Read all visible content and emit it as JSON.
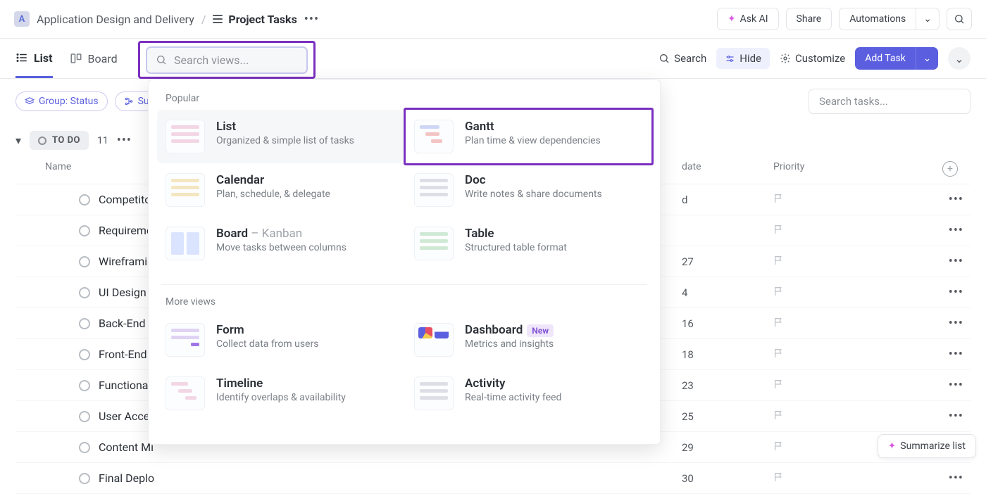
{
  "header": {
    "app_letter": "A",
    "breadcrumb_project": "Application Design and Delivery",
    "page_title": "Project Tasks",
    "ask_ai": "Ask AI",
    "share": "Share",
    "automations": "Automations"
  },
  "views_bar": {
    "list_tab": "List",
    "board_tab": "Board",
    "search": "Search",
    "hide": "Hide",
    "customize": "Customize",
    "add_task": "Add Task"
  },
  "search_views": {
    "placeholder": "Search views..."
  },
  "filters": {
    "group_status": "Group: Status",
    "su_chip": "Su",
    "search_tasks_placeholder": "Search tasks..."
  },
  "status": {
    "label": "TO DO",
    "count": "11"
  },
  "columns": {
    "name": "Name",
    "date": "date",
    "priority": "Priority"
  },
  "tasks": [
    {
      "name": "Competitor",
      "date": "d"
    },
    {
      "name": "Requireme",
      "date": ""
    },
    {
      "name": "Wireframin",
      "date": "27"
    },
    {
      "name": "UI Design",
      "date": "4"
    },
    {
      "name": "Back-End D",
      "date": "16"
    },
    {
      "name": "Front-End",
      "date": "18"
    },
    {
      "name": "Functionali",
      "date": "23"
    },
    {
      "name": "User Accep",
      "date": "25"
    },
    {
      "name": "Content Mi",
      "date": "29"
    },
    {
      "name": "Final Deplo",
      "date": "30"
    }
  ],
  "popover": {
    "popular_label": "Popular",
    "more_label": "More views",
    "items": {
      "list": {
        "title": "List",
        "sub": "Organized & simple list of tasks"
      },
      "gantt": {
        "title": "Gantt",
        "sub": "Plan time & view dependencies"
      },
      "calendar": {
        "title": "Calendar",
        "sub": "Plan, schedule, & delegate"
      },
      "doc": {
        "title": "Doc",
        "sub": "Write notes & share documents"
      },
      "board": {
        "title": "Board",
        "kanban": " – Kanban",
        "sub": "Move tasks between columns"
      },
      "table": {
        "title": "Table",
        "sub": "Structured table format"
      },
      "form": {
        "title": "Form",
        "sub": "Collect data from users"
      },
      "dashboard": {
        "title": "Dashboard",
        "sub": "Metrics and insights",
        "new": "New"
      },
      "timeline": {
        "title": "Timeline",
        "sub": "Identify overlaps & availability"
      },
      "activity": {
        "title": "Activity",
        "sub": "Real-time activity feed"
      }
    }
  },
  "summarize": "Summarize list"
}
